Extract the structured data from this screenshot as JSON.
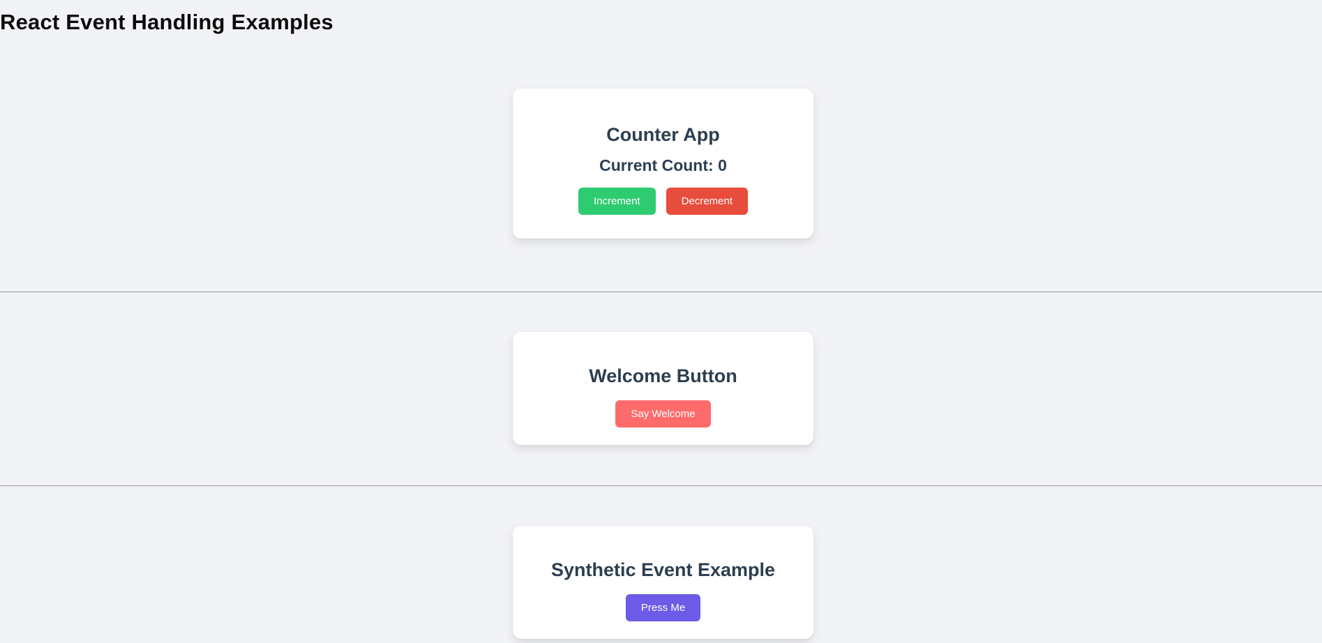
{
  "page": {
    "title": "React Event Handling Examples"
  },
  "counter_app": {
    "title": "Counter App",
    "count_label": "Current Count: ",
    "count_value": "0",
    "increment_label": "Increment",
    "decrement_label": "Decrement"
  },
  "welcome_card": {
    "title": "Welcome Button",
    "button_label": "Say Welcome"
  },
  "synthetic_card": {
    "title": "Synthetic Event Example",
    "button_label": "Press Me"
  },
  "colors": {
    "background": "#f2f3f7",
    "heading_text": "#2c3e50",
    "increment_button": "#2ecc71",
    "decrement_button": "#e74c3c",
    "welcome_button": "#ff6b6b",
    "press_button": "#6c5ce7"
  }
}
